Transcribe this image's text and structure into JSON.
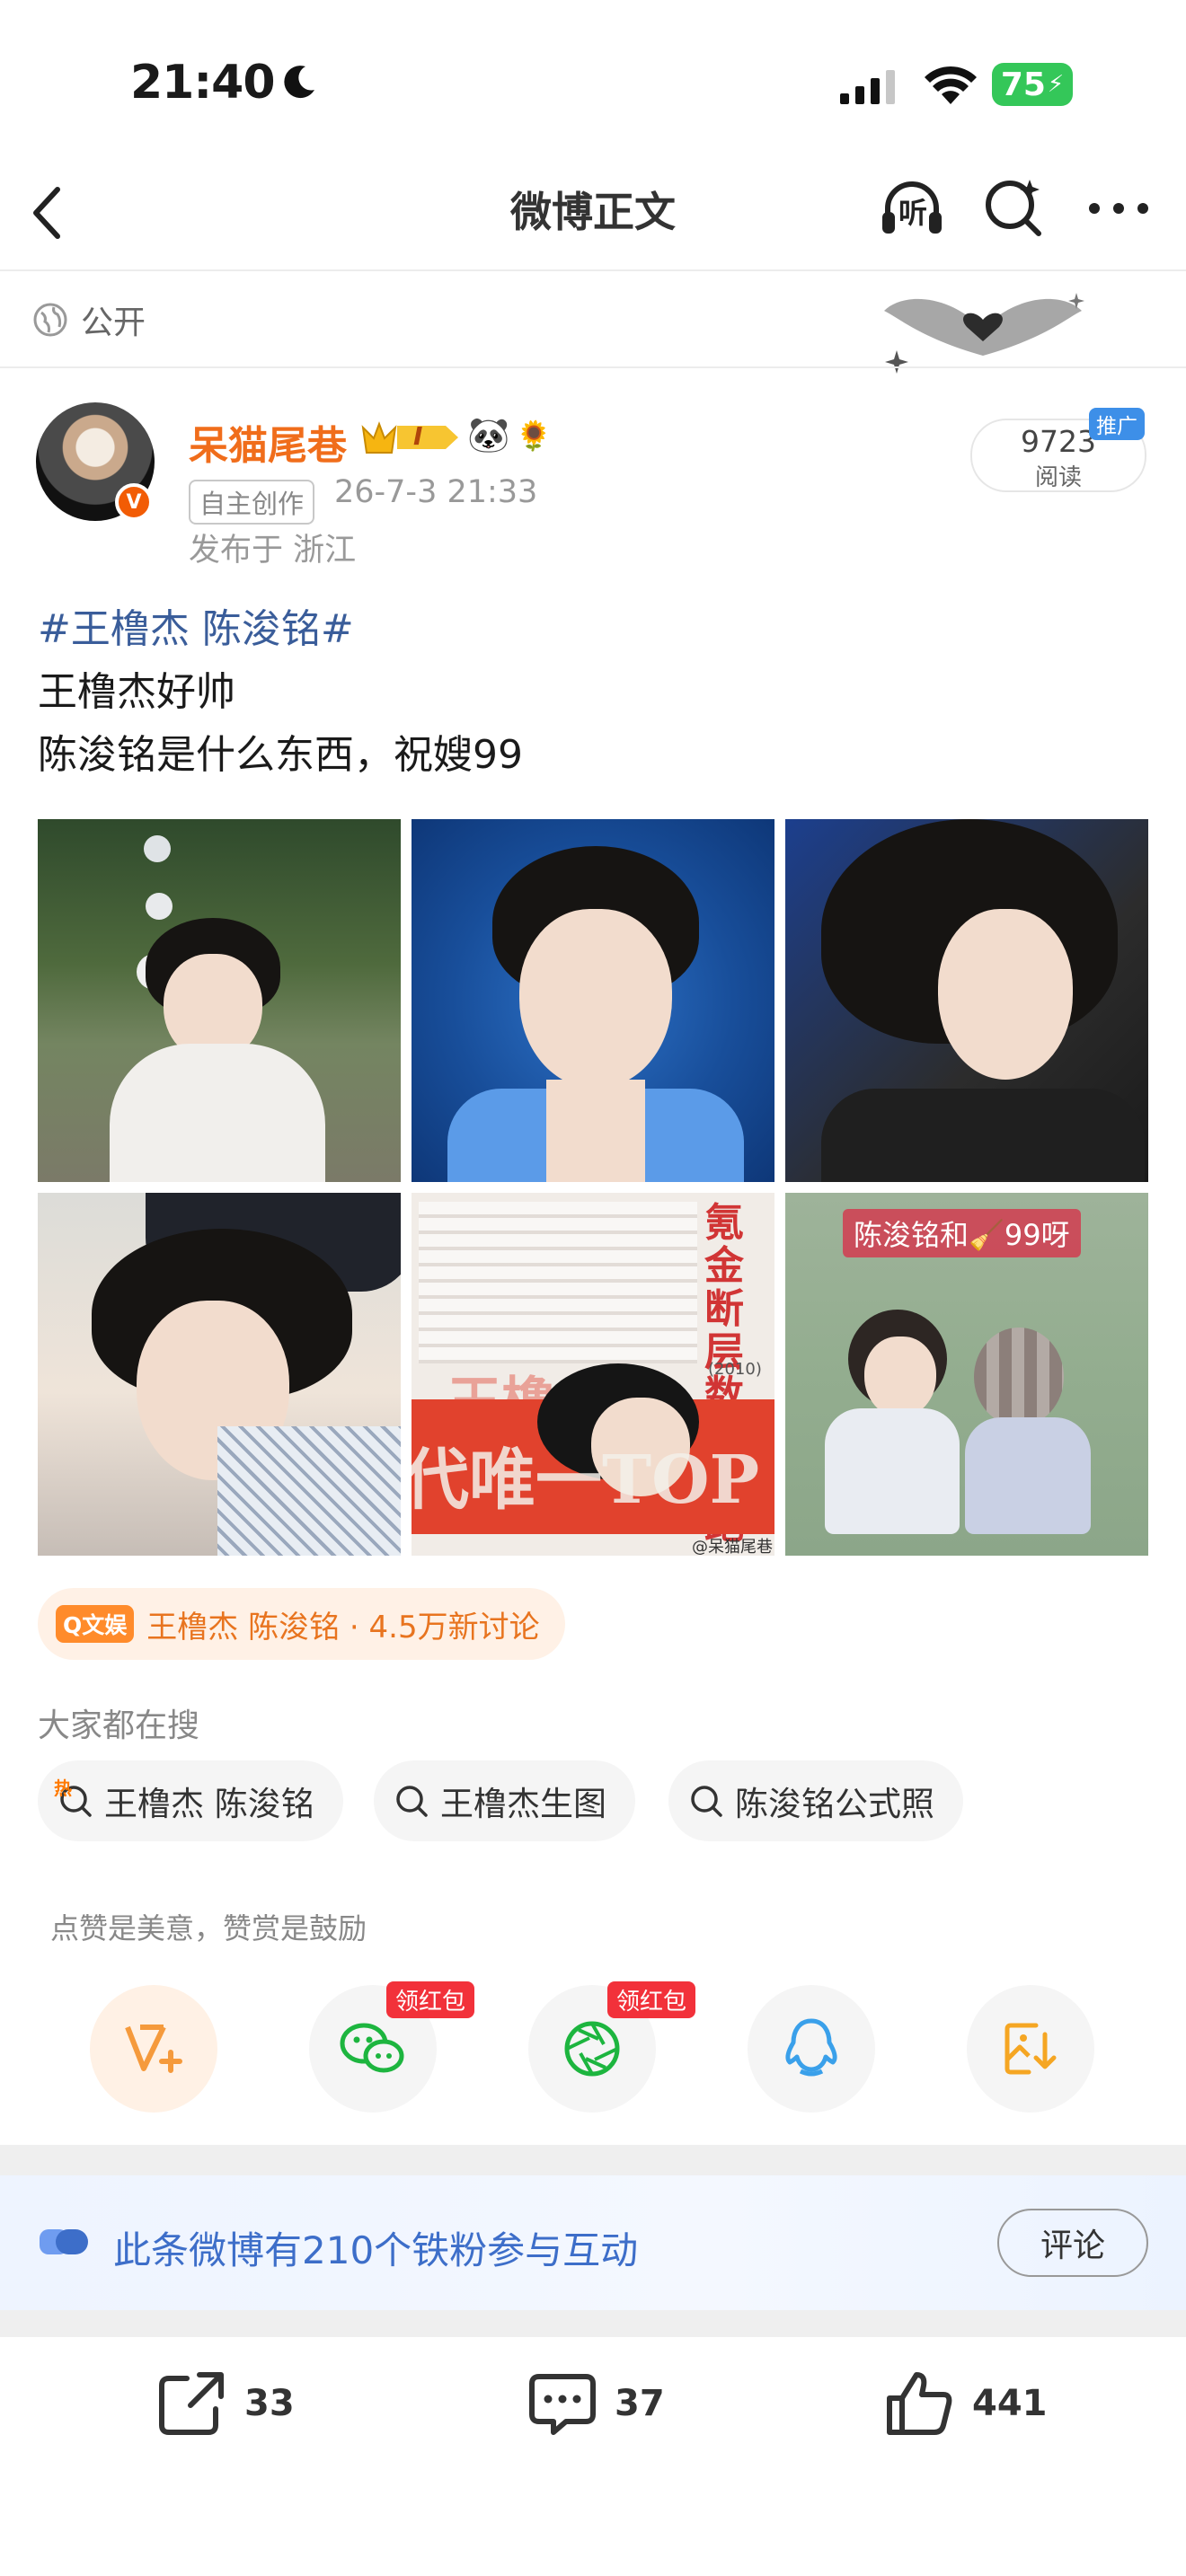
{
  "status_bar": {
    "time": "21:40",
    "battery": "75"
  },
  "nav": {
    "title": "微博正文",
    "listen_label": "听"
  },
  "visibility": {
    "label": "公开"
  },
  "author": {
    "name": "呆猫尾巷",
    "badge_level": "I",
    "tag": "自主创作",
    "time": "26-7-3 21:33",
    "location": "发布于 浙江",
    "read_count": "9723",
    "read_label": "阅读",
    "ad_label": "推广"
  },
  "post": {
    "topic": "#王橹杰 陈浚铭#",
    "lines": [
      "王橹杰好帅",
      "陈浚铭是什么东西，祝嫂99"
    ]
  },
  "images": {
    "img5_headline": "王橹杰",
    "img5_tagline": "代唯一TOP",
    "img5_side": "氪金 断层 数据 领跑",
    "img5_year": "(2010)",
    "img5_watermark": "@呆猫尾巷",
    "img6_caption": "陈浚铭和🧹99呀"
  },
  "super_topic": {
    "badge": "文娱",
    "text": "王橹杰 陈浚铭 · 4.5万新讨论"
  },
  "search": {
    "heading": "大家都在搜",
    "hot_badge": "热",
    "items": [
      "王橹杰 陈浚铭",
      "王橹杰生图",
      "陈浚铭公式照"
    ]
  },
  "share": {
    "tip": "点赞是美意，赞赏是鼓励",
    "hongbao_label": "领红包"
  },
  "fan": {
    "text": "此条微博有210个铁粉参与互动",
    "comment_button": "评论"
  },
  "actions": {
    "repost_count": "33",
    "comment_count": "37",
    "like_count": "441"
  },
  "colors": {
    "accent_orange": "#f06d1b",
    "link_blue": "#3a5d9a",
    "fan_blue": "#3d6ec9",
    "battery_green": "#34c759",
    "hongbao_red": "#f2313a"
  }
}
